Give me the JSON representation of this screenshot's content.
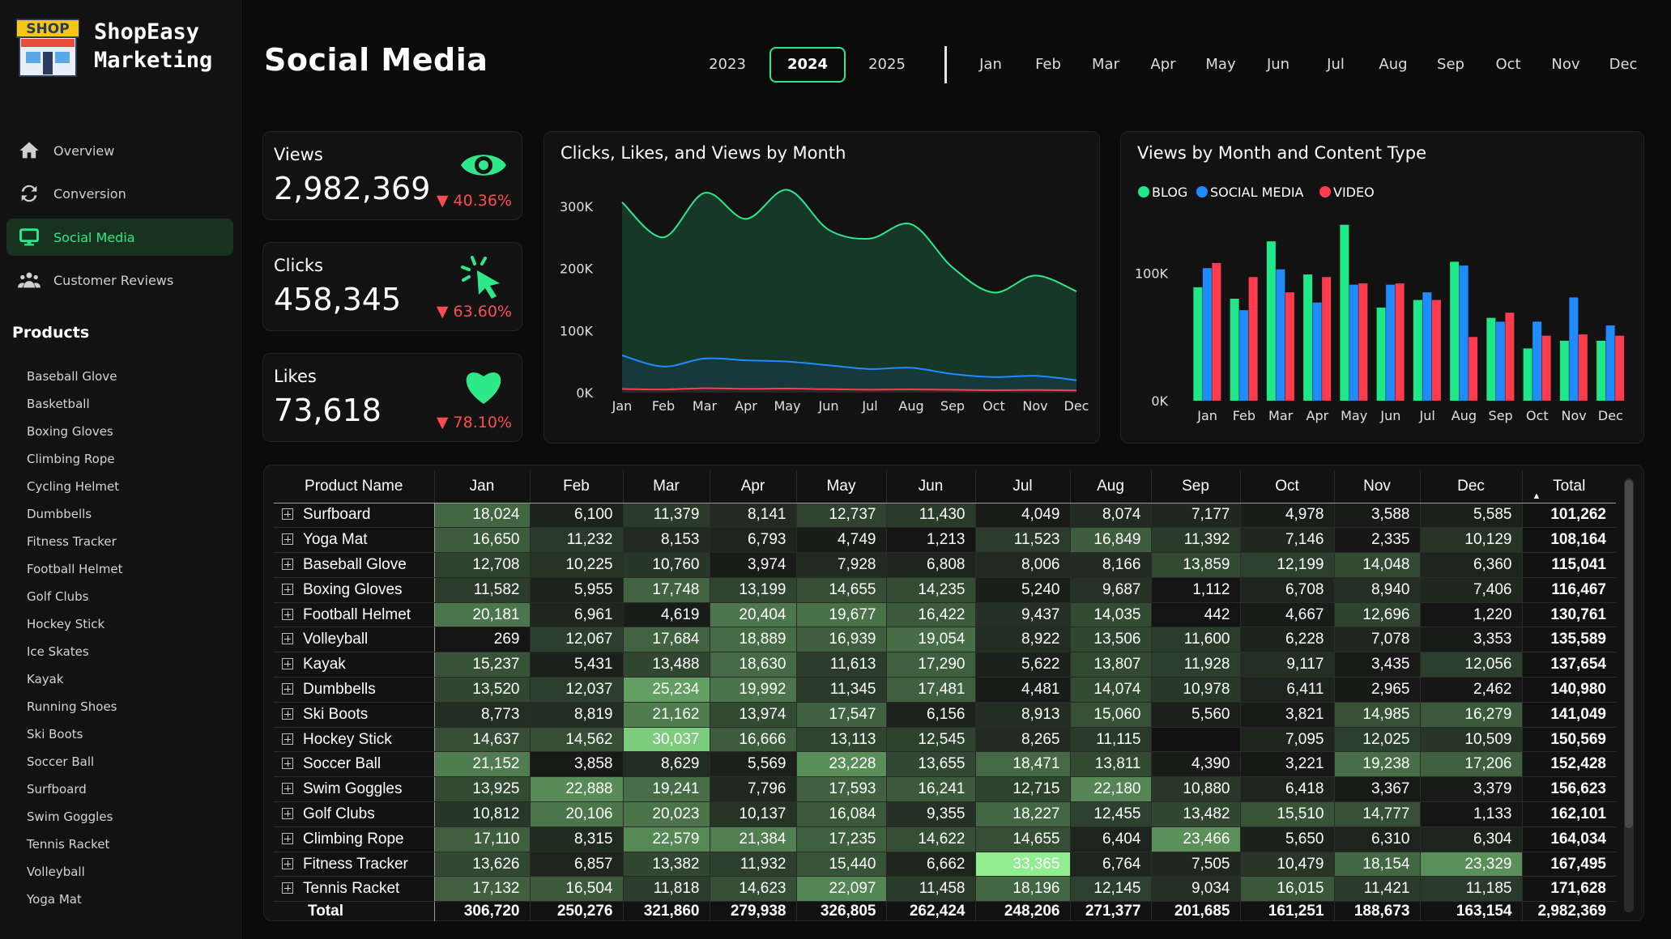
{
  "brand": {
    "line1": "ShopEasy",
    "line2": "Marketing",
    "logo_text": "SHOP"
  },
  "nav": [
    {
      "label": "Overview",
      "icon": "home-icon",
      "active": false
    },
    {
      "label": "Conversion",
      "icon": "refresh-icon",
      "active": false
    },
    {
      "label": "Social Media",
      "icon": "monitor-icon",
      "active": true
    },
    {
      "label": "Customer Reviews",
      "icon": "people-icon",
      "active": false
    }
  ],
  "products_heading": "Products",
  "products": [
    "Baseball Glove",
    "Basketball",
    "Boxing Gloves",
    "Climbing Rope",
    "Cycling Helmet",
    "Dumbbells",
    "Fitness Tracker",
    "Football Helmet",
    "Golf Clubs",
    "Hockey Stick",
    "Ice Skates",
    "Kayak",
    "Running Shoes",
    "Ski Boots",
    "Soccer Ball",
    "Surfboard",
    "Swim Goggles",
    "Tennis Racket",
    "Volleyball",
    "Yoga Mat"
  ],
  "page_title": "Social Media",
  "years": [
    {
      "label": "2023",
      "active": false
    },
    {
      "label": "2024",
      "active": true
    },
    {
      "label": "2025",
      "active": false
    }
  ],
  "months": [
    "Jan",
    "Feb",
    "Mar",
    "Apr",
    "May",
    "Jun",
    "Jul",
    "Aug",
    "Sep",
    "Oct",
    "Nov",
    "Dec"
  ],
  "kpis": {
    "views": {
      "label": "Views",
      "value": "2,982,369",
      "change": "▼ 40.36%",
      "icon": "eye-icon"
    },
    "clicks": {
      "label": "Clicks",
      "value": "458,345",
      "change": "▼ 63.60%",
      "icon": "cursor-click-icon"
    },
    "likes": {
      "label": "Likes",
      "value": "73,618",
      "change": "▼ 78.10%",
      "icon": "heart-icon"
    }
  },
  "colors": {
    "accent": "#2ee88a",
    "blog": "#1ee887",
    "social_media": "#1f8bff",
    "video": "#ff3b4f",
    "negative": "#ff4d4f"
  },
  "chart_data": [
    {
      "type": "area",
      "title": "Clicks, Likes, and Views by Month",
      "categories": [
        "Jan",
        "Feb",
        "Mar",
        "Apr",
        "May",
        "Jun",
        "Jul",
        "Aug",
        "Sep",
        "Oct",
        "Nov",
        "Dec"
      ],
      "y_ticks": [
        "0K",
        "100K",
        "200K",
        "300K"
      ],
      "ylim": [
        0,
        300000
      ],
      "series": [
        {
          "values": [
            306720,
            250276,
            321860,
            279938,
            326805,
            262424,
            248206,
            271377,
            201685,
            161251,
            188673,
            163154
          ],
          "color": "#2ee88a"
        },
        {
          "values": [
            60000,
            42000,
            55000,
            52000,
            50000,
            44000,
            38000,
            40000,
            30000,
            25000,
            27000,
            20000
          ],
          "color": "#1f8bff"
        },
        {
          "values": [
            6000,
            5000,
            7000,
            6000,
            6500,
            5500,
            4800,
            5200,
            4500,
            3800,
            4200,
            3500
          ],
          "color": "#ff3b4f"
        }
      ]
    },
    {
      "type": "bar",
      "title": "Views by Month and Content Type",
      "categories": [
        "Jan",
        "Feb",
        "Mar",
        "Apr",
        "May",
        "Jun",
        "Jul",
        "Aug",
        "Sep",
        "Oct",
        "Nov",
        "Dec"
      ],
      "y_ticks": [
        "0K",
        "100K"
      ],
      "ylim": [
        0,
        160000
      ],
      "legend": [
        "BLOG",
        "SOCIAL MEDIA",
        "VIDEO"
      ],
      "series": [
        {
          "name": "BLOG",
          "values": [
            89000,
            80000,
            125000,
            99000,
            138000,
            73000,
            79000,
            109000,
            65000,
            41000,
            47000,
            47000
          ]
        },
        {
          "name": "SOCIAL MEDIA",
          "values": [
            104000,
            71000,
            103000,
            77000,
            91000,
            91000,
            85000,
            106000,
            62000,
            62000,
            81000,
            59000
          ]
        },
        {
          "name": "VIDEO",
          "values": [
            108000,
            97000,
            85000,
            97000,
            92000,
            92000,
            79000,
            50000,
            69000,
            51000,
            52000,
            51000
          ]
        }
      ]
    }
  ],
  "table": {
    "headers": [
      "Product Name",
      "Jan",
      "Feb",
      "Mar",
      "Apr",
      "May",
      "Jun",
      "Jul",
      "Aug",
      "Sep",
      "Oct",
      "Nov",
      "Dec",
      "Total"
    ],
    "rows": [
      {
        "name": "Surfboard",
        "values": [
          "18,024",
          "6,100",
          "11,379",
          "8,141",
          "12,737",
          "11,430",
          "4,049",
          "8,074",
          "7,177",
          "4,978",
          "3,588",
          "5,585"
        ],
        "total": "101,262"
      },
      {
        "name": "Yoga Mat",
        "values": [
          "16,650",
          "11,232",
          "8,153",
          "6,793",
          "4,749",
          "1,213",
          "11,523",
          "16,849",
          "11,392",
          "7,146",
          "2,335",
          "10,129"
        ],
        "total": "108,164"
      },
      {
        "name": "Baseball Glove",
        "values": [
          "12,708",
          "10,225",
          "10,760",
          "3,974",
          "7,928",
          "6,808",
          "8,006",
          "8,166",
          "13,859",
          "12,199",
          "14,048",
          "6,360"
        ],
        "total": "115,041"
      },
      {
        "name": "Boxing Gloves",
        "values": [
          "11,582",
          "5,955",
          "17,748",
          "13,199",
          "14,655",
          "14,235",
          "5,240",
          "9,687",
          "1,112",
          "6,708",
          "8,940",
          "7,406"
        ],
        "total": "116,467"
      },
      {
        "name": "Football Helmet",
        "values": [
          "20,181",
          "6,961",
          "4,619",
          "20,404",
          "19,677",
          "16,422",
          "9,437",
          "14,035",
          "442",
          "4,667",
          "12,696",
          "1,220"
        ],
        "total": "130,761"
      },
      {
        "name": "Volleyball",
        "values": [
          "269",
          "12,067",
          "17,684",
          "18,889",
          "16,939",
          "19,054",
          "8,922",
          "13,506",
          "11,600",
          "6,228",
          "7,078",
          "3,353"
        ],
        "total": "135,589"
      },
      {
        "name": "Kayak",
        "values": [
          "15,237",
          "5,431",
          "13,488",
          "18,630",
          "11,613",
          "17,290",
          "5,622",
          "13,807",
          "11,928",
          "9,117",
          "3,435",
          "12,056"
        ],
        "total": "137,654"
      },
      {
        "name": "Dumbbells",
        "values": [
          "13,520",
          "12,037",
          "25,234",
          "19,992",
          "11,345",
          "17,481",
          "4,481",
          "14,074",
          "10,978",
          "6,411",
          "2,965",
          "2,462"
        ],
        "total": "140,980"
      },
      {
        "name": "Ski Boots",
        "values": [
          "8,773",
          "8,819",
          "21,162",
          "13,974",
          "17,547",
          "6,156",
          "8,913",
          "15,060",
          "5,560",
          "3,821",
          "14,985",
          "16,279"
        ],
        "total": "141,049"
      },
      {
        "name": "Hockey Stick",
        "values": [
          "14,637",
          "14,562",
          "30,037",
          "16,666",
          "13,113",
          "12,545",
          "8,265",
          "11,115",
          "",
          "7,095",
          "12,025",
          "10,509"
        ],
        "total": "150,569"
      },
      {
        "name": "Soccer Ball",
        "values": [
          "21,152",
          "3,858",
          "8,629",
          "5,569",
          "23,228",
          "13,655",
          "18,471",
          "13,811",
          "4,390",
          "3,221",
          "19,238",
          "17,206"
        ],
        "total": "152,428"
      },
      {
        "name": "Swim Goggles",
        "values": [
          "13,925",
          "22,888",
          "19,241",
          "7,796",
          "17,593",
          "16,241",
          "12,715",
          "22,180",
          "10,880",
          "6,418",
          "3,367",
          "3,379"
        ],
        "total": "156,623"
      },
      {
        "name": "Golf Clubs",
        "values": [
          "10,812",
          "20,106",
          "20,023",
          "10,137",
          "16,084",
          "9,355",
          "18,227",
          "12,455",
          "13,482",
          "15,510",
          "14,777",
          "1,133"
        ],
        "total": "162,101"
      },
      {
        "name": "Climbing Rope",
        "values": [
          "17,110",
          "8,315",
          "22,579",
          "21,384",
          "17,235",
          "14,622",
          "14,655",
          "6,404",
          "23,466",
          "5,650",
          "6,310",
          "6,304"
        ],
        "total": "164,034"
      },
      {
        "name": "Fitness Tracker",
        "values": [
          "13,626",
          "6,857",
          "13,382",
          "11,932",
          "15,440",
          "6,662",
          "33,365",
          "6,764",
          "7,505",
          "10,479",
          "18,154",
          "23,329"
        ],
        "total": "167,495"
      },
      {
        "name": "Tennis Racket",
        "values": [
          "17,132",
          "16,504",
          "11,818",
          "14,623",
          "22,097",
          "11,458",
          "18,196",
          "12,145",
          "9,034",
          "16,015",
          "11,421",
          "11,185"
        ],
        "total": "171,628"
      }
    ],
    "totals_label": "Total",
    "totals": [
      "306,720",
      "250,276",
      "321,860",
      "279,938",
      "326,805",
      "262,424",
      "248,206",
      "271,377",
      "201,685",
      "161,251",
      "188,673",
      "163,154"
    ],
    "grand_total": "2,982,369"
  }
}
